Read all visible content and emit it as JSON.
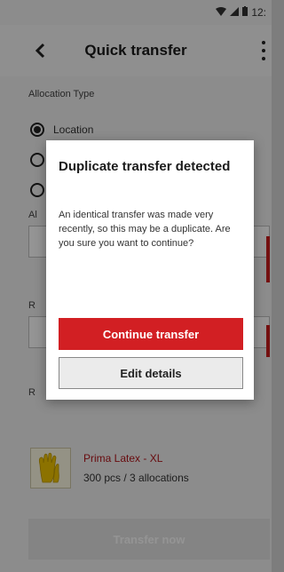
{
  "status_bar": {
    "time": "12:"
  },
  "header": {
    "title": "Quick transfer"
  },
  "form": {
    "allocation_type_label": "Allocation Type",
    "options": [
      "Location",
      "",
      ""
    ],
    "label_a_fragment": "Al",
    "label_b_fragment": "R",
    "label_c_fragment": "R"
  },
  "item": {
    "name": "Prima Latex - XL",
    "meta": "300 pcs / 3 allocations"
  },
  "footer": {
    "transfer_button": "Transfer now"
  },
  "dialog": {
    "title": "Duplicate transfer detected",
    "message": "An identical transfer was made very recently, so this may be a duplicate. Are you sure you want to continue?",
    "continue_label": "Continue transfer",
    "edit_label": "Edit details"
  },
  "icons": {
    "back": "chevron-left-icon",
    "menu": "more-vert-icon",
    "wifi": "wifi-icon",
    "signal": "signal-icon",
    "battery": "battery-icon",
    "item_thumbnail": "gloves-icon"
  },
  "colors": {
    "accent": "#d21f23",
    "item_name": "#b3151b"
  }
}
